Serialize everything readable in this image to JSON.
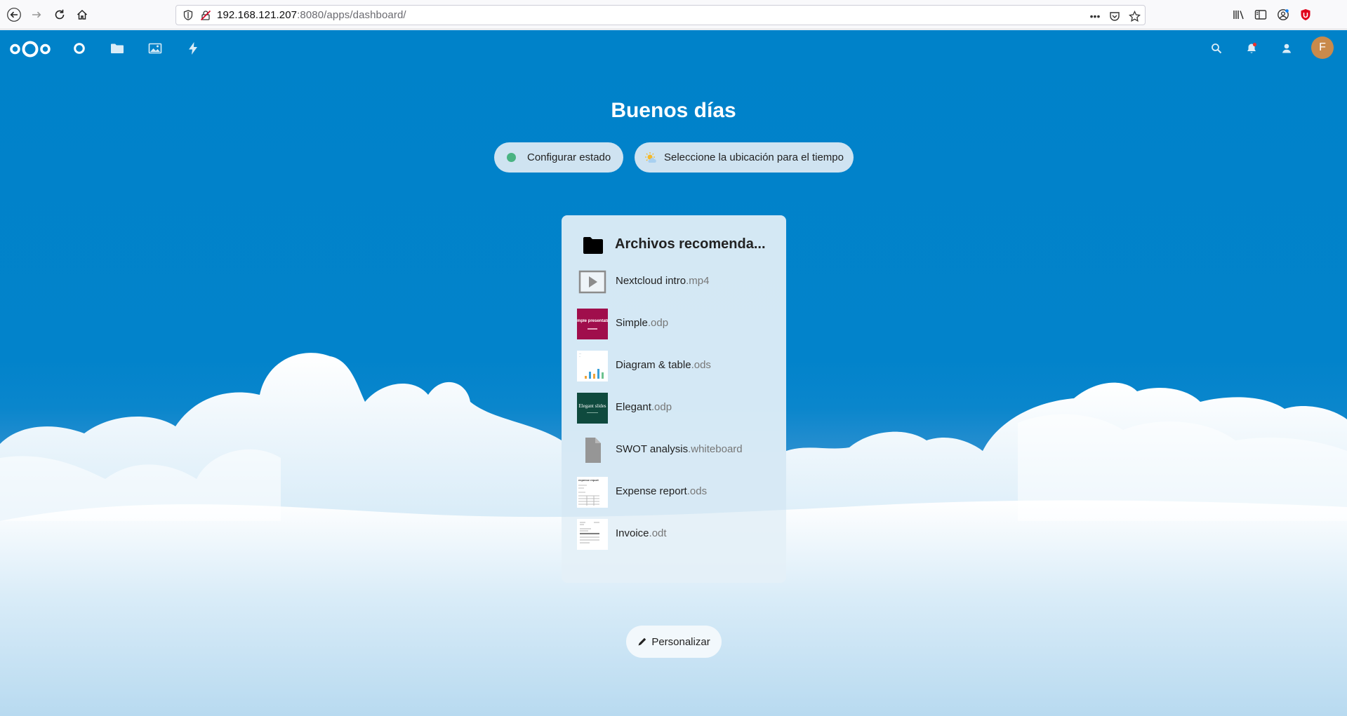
{
  "browser": {
    "url_host": "192.168.121.207",
    "url_rest": ":8080/apps/dashboard/",
    "icons": [
      "back-icon",
      "forward-icon",
      "reload-icon",
      "home-icon",
      "shield-icon",
      "insecure-lock-icon",
      "more-icon",
      "pocket-icon",
      "bookmark-star-icon",
      "library-icon",
      "sidebar-icon",
      "account-icon",
      "ublock-icon"
    ]
  },
  "header": {
    "apps": [
      "dashboard-app-icon",
      "files-app-icon",
      "photos-app-icon",
      "activity-app-icon"
    ],
    "avatar_letter": "F",
    "avatar_color": "#c98a4b"
  },
  "greeting": "Buenos días",
  "status_button": "Configurar estado",
  "weather_button": "Seleccione la ubicación para el tiempo",
  "recommended": {
    "title": "Archivos recomenda...",
    "files": [
      {
        "name": "Nextcloud intro",
        "ext": ".mp4",
        "thumb": "video"
      },
      {
        "name": "Simple",
        "ext": ".odp",
        "thumb": "simple",
        "thumb_text": "mple presentati"
      },
      {
        "name": "Diagram & table",
        "ext": ".ods",
        "thumb": "diagram"
      },
      {
        "name": "Elegant",
        "ext": ".odp",
        "thumb": "elegant",
        "thumb_text": "Elegant slides"
      },
      {
        "name": "SWOT analysis",
        "ext": ".whiteboard",
        "thumb": "generic"
      },
      {
        "name": "Expense report",
        "ext": ".ods",
        "thumb": "expense",
        "thumb_text": "expense report"
      },
      {
        "name": "Invoice",
        "ext": ".odt",
        "thumb": "invoice"
      }
    ]
  },
  "customize_button": "Personalizar",
  "colors": {
    "brand": "#0082c9",
    "status_online": "#49b382"
  }
}
